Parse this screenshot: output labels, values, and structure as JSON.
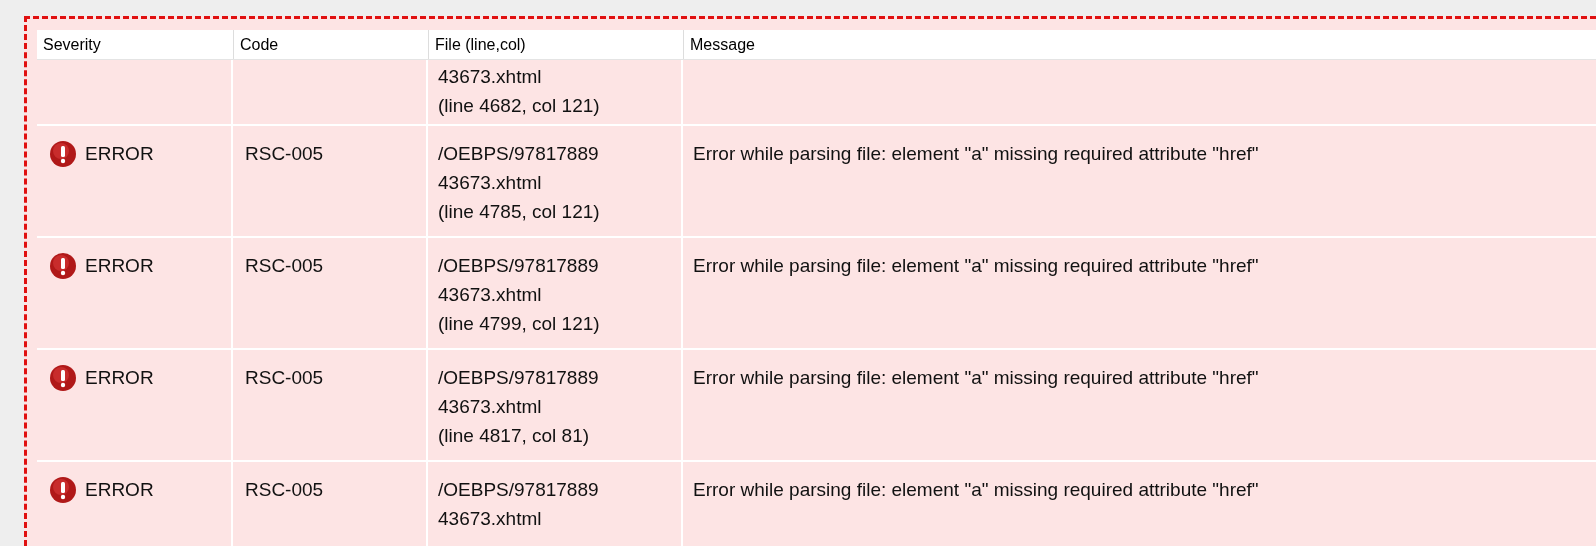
{
  "table": {
    "columns": [
      "Severity",
      "Code",
      "File (line,col)",
      "Message"
    ],
    "rows": [
      {
        "kind": "partial",
        "file_lines": [
          "43673.xhtml",
          "(line 4682, col 121)"
        ]
      },
      {
        "kind": "full",
        "severity": "ERROR",
        "code": "RSC-005",
        "file_lines": [
          "/OEBPS/97817889",
          "43673.xhtml",
          "(line 4785, col 121)"
        ],
        "message": "Error while parsing file: element \"a\" missing required attribute \"href\""
      },
      {
        "kind": "full",
        "severity": "ERROR",
        "code": "RSC-005",
        "file_lines": [
          "/OEBPS/97817889",
          "43673.xhtml",
          "(line 4799, col 121)"
        ],
        "message": "Error while parsing file: element \"a\" missing required attribute \"href\""
      },
      {
        "kind": "full",
        "severity": "ERROR",
        "code": "RSC-005",
        "file_lines": [
          "/OEBPS/97817889",
          "43673.xhtml",
          "(line 4817, col 81)"
        ],
        "message": "Error while parsing file: element \"a\" missing required attribute \"href\""
      },
      {
        "kind": "full",
        "severity": "ERROR",
        "code": "RSC-005",
        "file_lines": [
          "/OEBPS/97817889",
          "43673.xhtml"
        ],
        "message": "Error while parsing file: element \"a\" missing required attribute \"href\""
      }
    ]
  }
}
